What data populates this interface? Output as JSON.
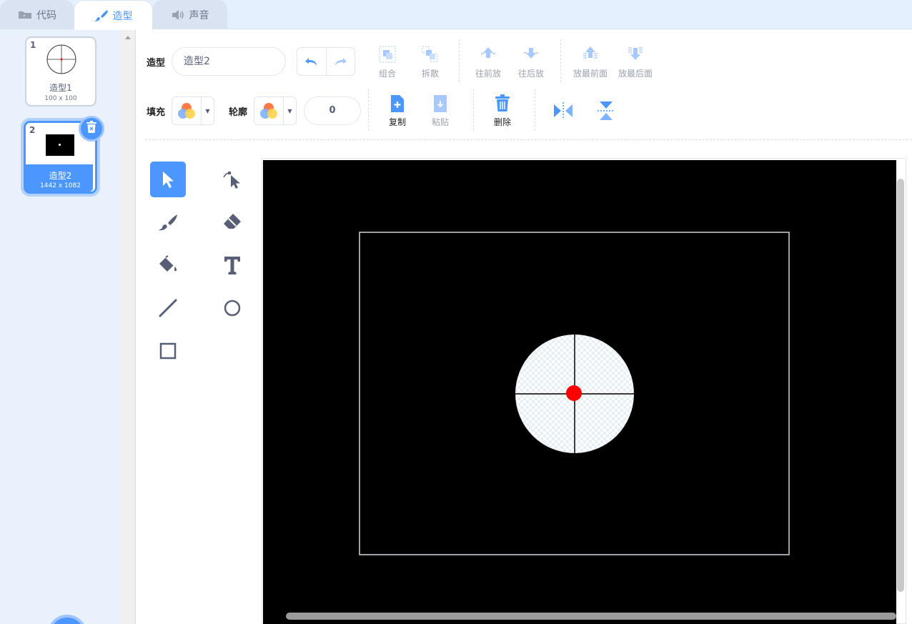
{
  "tabs": [
    {
      "label": "代码",
      "icon": "code-icon"
    },
    {
      "label": "造型",
      "icon": "brush-icon"
    },
    {
      "label": "声音",
      "icon": "speaker-icon"
    }
  ],
  "costumes": [
    {
      "number": "1",
      "name": "造型1",
      "size": "100 x 100"
    },
    {
      "number": "2",
      "name": "造型2",
      "size": "1442 x 1082"
    }
  ],
  "toolbar": {
    "costume_label": "造型",
    "costume_name": "造型2",
    "group": "组合",
    "ungroup": "拆散",
    "forward": "往前放",
    "backward": "往后放",
    "front": "放最前面",
    "back": "放最后面",
    "fill_label": "填充",
    "outline_label": "轮廓",
    "outline_width": "0",
    "copy": "复制",
    "paste": "粘贴",
    "delete": "删除"
  },
  "colors": {
    "accent": "#4c97ff",
    "canvas_bg": "#000000",
    "target_dot": "#ff0000"
  }
}
